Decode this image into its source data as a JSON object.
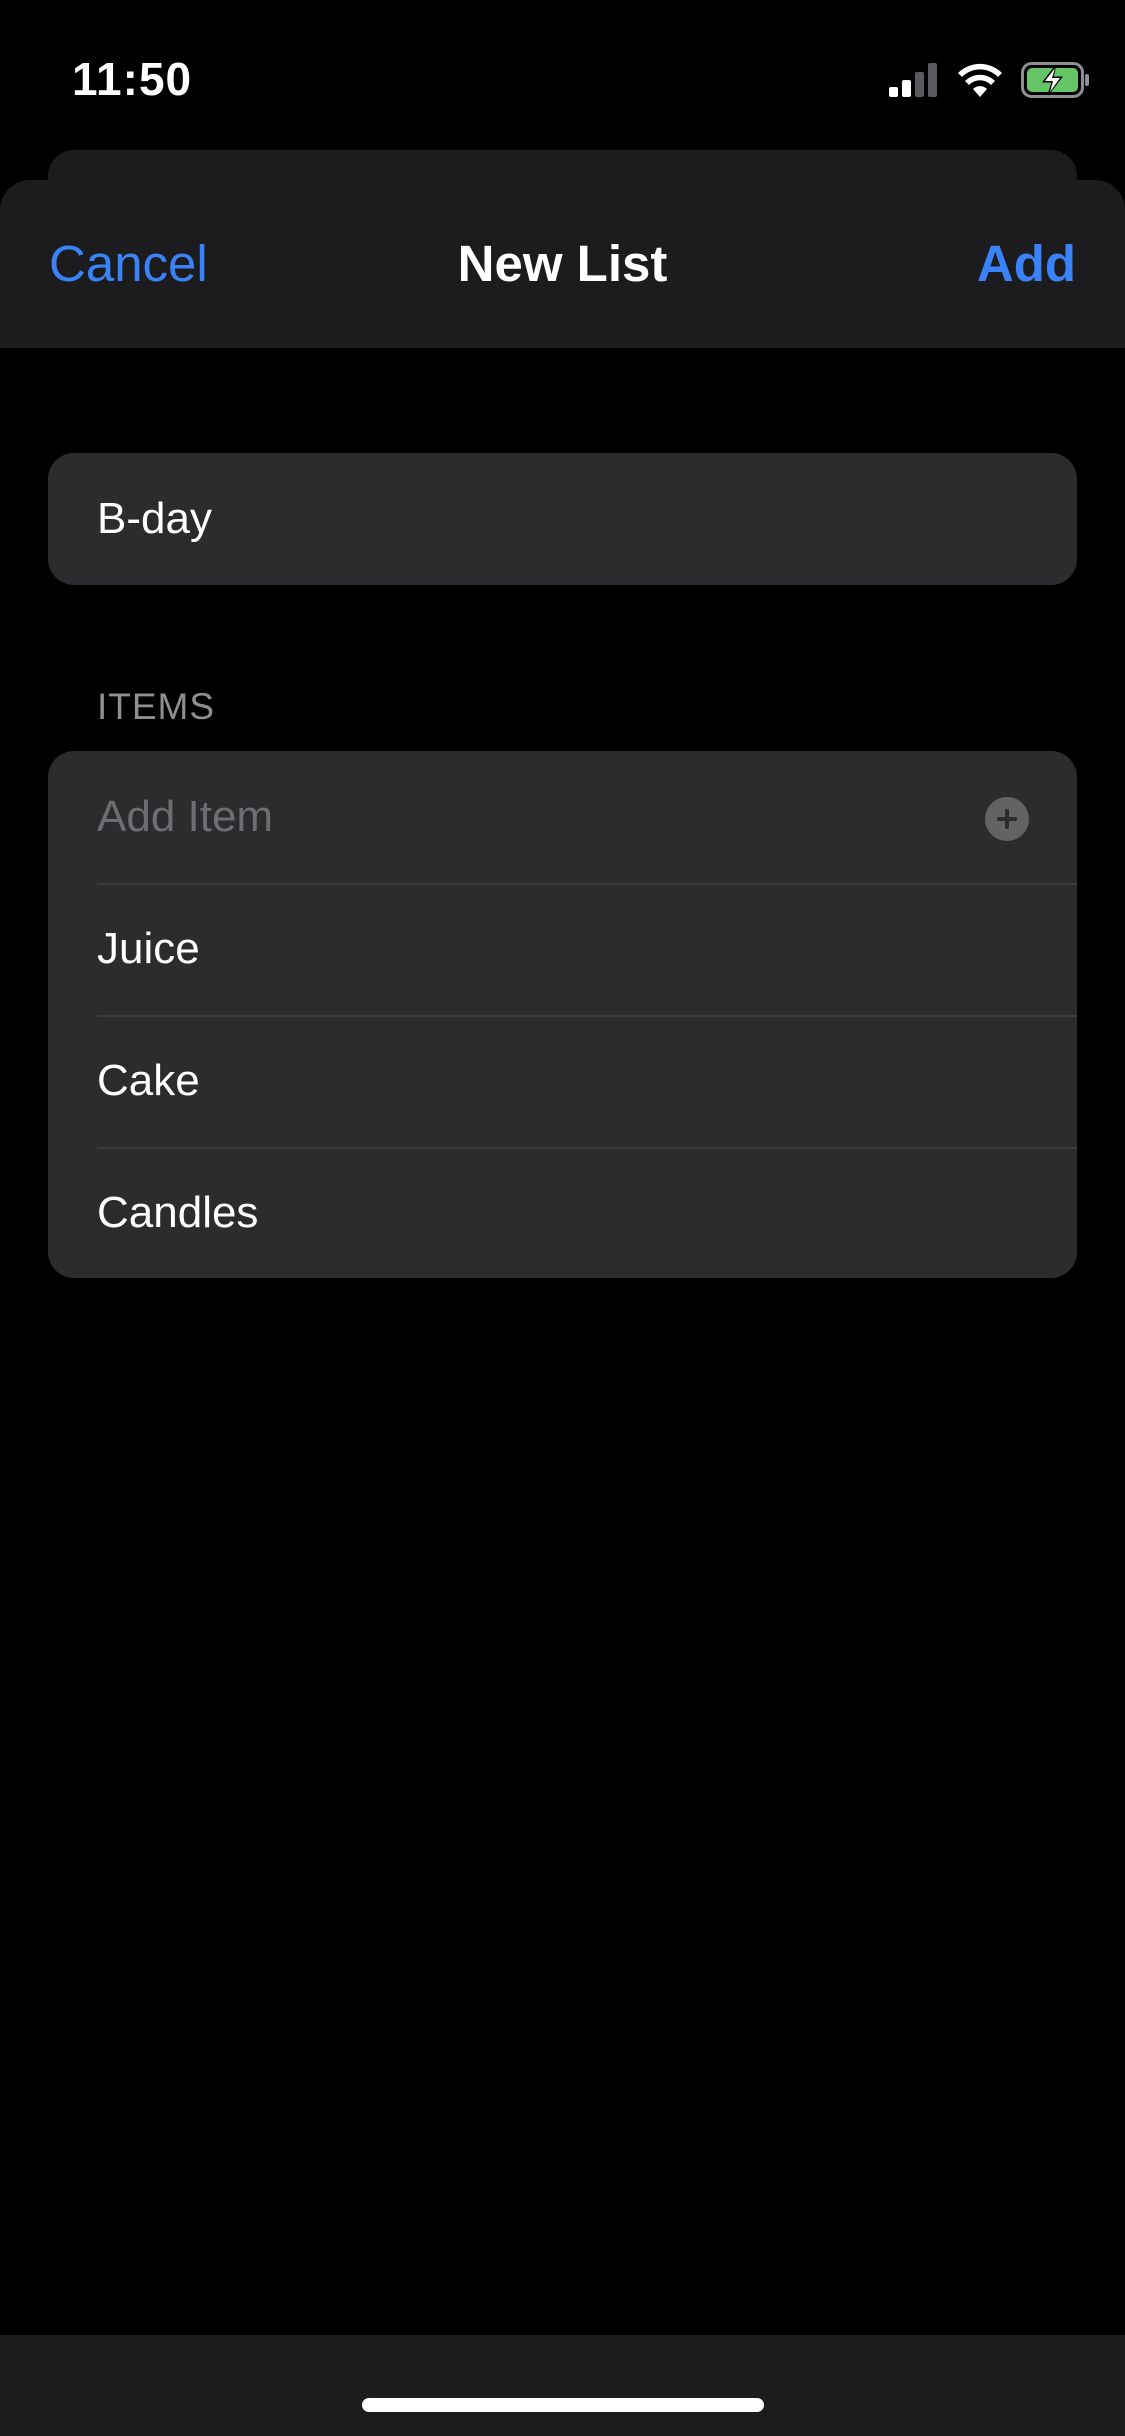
{
  "status_bar": {
    "time": "11:50",
    "icons": [
      "cellular-signal-icon",
      "wifi-icon",
      "battery-charging-icon"
    ]
  },
  "nav": {
    "cancel_label": "Cancel",
    "title": "New List",
    "add_label": "Add"
  },
  "list_name": {
    "value": "B-day"
  },
  "items_section": {
    "header": "ITEMS",
    "add_placeholder": "Add Item",
    "add_icon": "plus-circle-icon",
    "items": [
      {
        "label": "Juice"
      },
      {
        "label": "Cake"
      },
      {
        "label": "Candles"
      }
    ]
  },
  "colors": {
    "accent": "#3a82f7",
    "background": "#000000",
    "grouped_cell": "#2c2c2e",
    "nav_background": "#1c1c1e",
    "secondary_text": "#8e8e93",
    "battery_green": "#65c466"
  }
}
